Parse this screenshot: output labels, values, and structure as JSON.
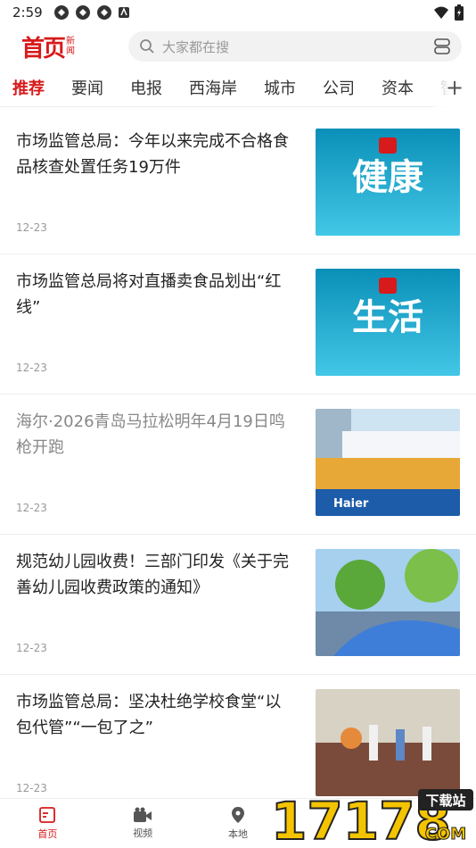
{
  "status_bar": {
    "time": "2:59"
  },
  "header": {
    "logo_main": "首页",
    "logo_sub": "新闻",
    "search_placeholder": "大家都在搜"
  },
  "tabs": [
    {
      "label": "推荐",
      "active": true
    },
    {
      "label": "要闻"
    },
    {
      "label": "电报"
    },
    {
      "label": "西海岸"
    },
    {
      "label": "城市"
    },
    {
      "label": "公司"
    },
    {
      "label": "资本"
    },
    {
      "label": "智"
    }
  ],
  "tab_more": "+",
  "news": [
    {
      "title": "市场监管总局：今年以来完成不合格食品核查处置任务19万件",
      "date": "12-23",
      "thumb_text": "健康",
      "read": false
    },
    {
      "title": "市场监管总局将对直播卖食品划出“红线”",
      "date": "12-23",
      "thumb_text": "生活",
      "read": false
    },
    {
      "title": "海尔·2026青岛马拉松明年4月19日鸣枪开跑",
      "date": "12-23",
      "thumb_text": "Haier",
      "read": true
    },
    {
      "title": "规范幼儿园收费！三部门印发《关于完善幼儿园收费政策的通知》",
      "date": "12-23",
      "read": false
    },
    {
      "title": "市场监管总局：坚决杜绝学校食堂“以包代管”“一包了之”",
      "date": "12-23",
      "read": false
    }
  ],
  "bottom_nav": [
    {
      "label": "首页",
      "icon": "home-icon",
      "active": true
    },
    {
      "label": "视频",
      "icon": "video-icon"
    },
    {
      "label": "本地",
      "icon": "location-icon"
    }
  ],
  "watermark": {
    "text": "17178",
    "badge": "下载站",
    "suffix": "COM"
  },
  "colors": {
    "brand": "#d71a1b"
  }
}
